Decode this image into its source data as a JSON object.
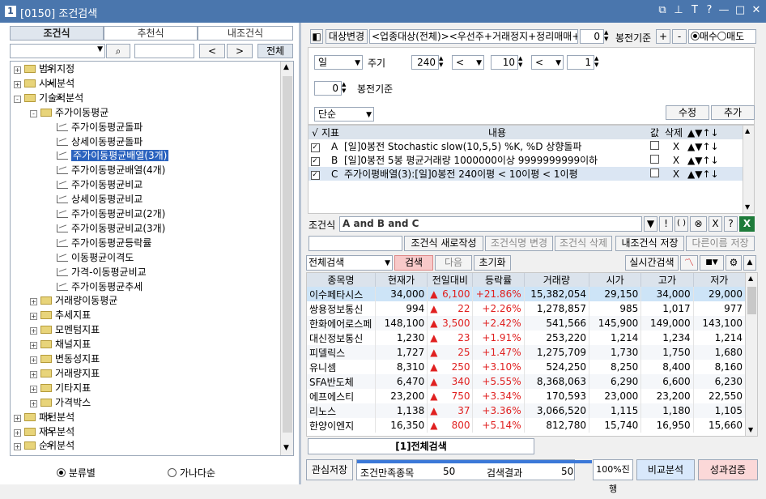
{
  "window": {
    "number": "1",
    "title": "[0150] 조건검색"
  },
  "left": {
    "tabs": [
      "조건식",
      "추천식",
      "내조건식"
    ],
    "all_button": "전체",
    "prev": "<",
    "next": ">",
    "tree": [
      {
        "label": "범위지정",
        "level": 0,
        "type": "folder",
        "pm": "+",
        "arrow": ">"
      },
      {
        "label": "시세분석",
        "level": 0,
        "type": "folder",
        "pm": "+",
        "arrow": ">"
      },
      {
        "label": "기술적분석",
        "level": 0,
        "type": "folder",
        "pm": "-",
        "arrow": ">"
      },
      {
        "label": "주가이동평균",
        "level": 1,
        "type": "folder",
        "pm": "-"
      },
      {
        "label": "주가이동평균돌파",
        "level": 2,
        "type": "item"
      },
      {
        "label": "상세이동평균돌파",
        "level": 2,
        "type": "item"
      },
      {
        "label": "주가이동평균배열(3개)",
        "level": 2,
        "type": "item",
        "selected": true
      },
      {
        "label": "주가이동평균배열(4개)",
        "level": 2,
        "type": "item"
      },
      {
        "label": "주가이동평균비교",
        "level": 2,
        "type": "item"
      },
      {
        "label": "상세이동평균비교",
        "level": 2,
        "type": "item"
      },
      {
        "label": "주가이동평균비교(2개)",
        "level": 2,
        "type": "item"
      },
      {
        "label": "주가이동평균비교(3개)",
        "level": 2,
        "type": "item"
      },
      {
        "label": "주가이동평균등락률",
        "level": 2,
        "type": "item"
      },
      {
        "label": "이동평균이격도",
        "level": 2,
        "type": "item"
      },
      {
        "label": "가격-이동평균비교",
        "level": 2,
        "type": "item"
      },
      {
        "label": "주가이동평균추세",
        "level": 2,
        "type": "item"
      },
      {
        "label": "거래량이동평균",
        "level": 1,
        "type": "folder",
        "pm": "+"
      },
      {
        "label": "추세지표",
        "level": 1,
        "type": "folder",
        "pm": "+"
      },
      {
        "label": "모멘텀지표",
        "level": 1,
        "type": "folder",
        "pm": "+"
      },
      {
        "label": "채널지표",
        "level": 1,
        "type": "folder",
        "pm": "+"
      },
      {
        "label": "변동성지표",
        "level": 1,
        "type": "folder",
        "pm": "+"
      },
      {
        "label": "거래량지표",
        "level": 1,
        "type": "folder",
        "pm": "+"
      },
      {
        "label": "기타지표",
        "level": 1,
        "type": "folder",
        "pm": "+"
      },
      {
        "label": "가격박스",
        "level": 1,
        "type": "folder",
        "pm": "+"
      },
      {
        "label": "패턴분석",
        "level": 0,
        "type": "folder",
        "pm": "+",
        "arrow": ">"
      },
      {
        "label": "재무분석",
        "level": 0,
        "type": "folder",
        "pm": "+",
        "arrow": ">"
      },
      {
        "label": "순위분석",
        "level": 0,
        "type": "folder",
        "pm": "+",
        "arrow": ">"
      }
    ],
    "radio_category": "분류별",
    "radio_alpha": "가나다순"
  },
  "top": {
    "target_change": "대상변경",
    "target_text": "<업종대상(전체)><우선주+거래정지+정리매매+",
    "bong_value": "0",
    "bong_label": "봉전기준",
    "plus": "+",
    "minus": "-",
    "buy": "매수",
    "sell": "매도"
  },
  "params": {
    "period": "일",
    "period_label": "주기",
    "v1": "240",
    "op1": "<",
    "v2": "10",
    "op2": "<",
    "v3": "1",
    "bong": "0",
    "bong_label": "봉전기준",
    "mode": "단순",
    "edit": "수정",
    "add": "추가"
  },
  "cond_table": {
    "headers": [
      "√",
      "지표",
      "내용",
      "값",
      "삭제",
      "▲▼↑↓"
    ],
    "rows": [
      {
        "id": "A",
        "content": "[일]0봉전 Stochastic slow(10,5,5) %K, %D 상향돌파",
        "del": "X"
      },
      {
        "id": "B",
        "content": "[일]0봉전 5봉 평균거래량 1000000이상 9999999999이하",
        "del": "X"
      },
      {
        "id": "C",
        "content": "주가이평배열(3):[일]0봉전 240이평 < 10이평 < 1이평",
        "del": "X"
      }
    ]
  },
  "formula": {
    "label": "조건식",
    "text": "A and B and C",
    "btns": [
      "▼",
      "!",
      "( )",
      "⊗",
      "X",
      "?"
    ]
  },
  "actions": {
    "new_save": "조건식 새로작성",
    "rename": "조건식명 변경",
    "delete": "조건식 삭제",
    "my_save": "내조건식 저장",
    "save_as": "다른이름 저장"
  },
  "search": {
    "scope": "전체검색",
    "search": "검색",
    "next": "다음",
    "reset": "초기화",
    "realtime": "실시간검색"
  },
  "results": {
    "headers": [
      "종목명",
      "현재가",
      "전일대비",
      "등락률",
      "거래량",
      "시가",
      "고가",
      "저가"
    ],
    "rows": [
      [
        "이수페타시스",
        "34,000",
        "6,100",
        "+21.86%",
        "15,382,054",
        "29,150",
        "34,000",
        "29,000"
      ],
      [
        "쌍용정보통신",
        "994",
        "22",
        "+2.26%",
        "1,278,857",
        "985",
        "1,017",
        "977"
      ],
      [
        "한화에어로스페",
        "148,100",
        "3,500",
        "+2.42%",
        "541,566",
        "145,900",
        "149,000",
        "143,100"
      ],
      [
        "대신정보통신",
        "1,230",
        "23",
        "+1.91%",
        "253,220",
        "1,214",
        "1,234",
        "1,214"
      ],
      [
        "피델릭스",
        "1,727",
        "25",
        "+1.47%",
        "1,275,709",
        "1,730",
        "1,750",
        "1,680"
      ],
      [
        "유니셈",
        "8,310",
        "250",
        "+3.10%",
        "524,250",
        "8,250",
        "8,400",
        "8,160"
      ],
      [
        "SFA반도체",
        "6,470",
        "340",
        "+5.55%",
        "8,368,063",
        "6,290",
        "6,600",
        "6,230"
      ],
      [
        "에프에스티",
        "23,200",
        "750",
        "+3.34%",
        "170,593",
        "23,000",
        "23,200",
        "22,550"
      ],
      [
        "리노스",
        "1,138",
        "37",
        "+3.36%",
        "3,066,520",
        "1,115",
        "1,180",
        "1,105"
      ],
      [
        "한양이엔지",
        "16,350",
        "800",
        "+5.14%",
        "812,780",
        "15,740",
        "16,950",
        "15,660"
      ]
    ]
  },
  "bottom": {
    "tab": "[1]전체검색",
    "watch_save": "관심저장",
    "match_label": "조건만족종목",
    "match_value": "50",
    "result_label": "검색결과",
    "result_value": "50",
    "progress": "100%진행",
    "compare": "비교분석",
    "verify": "성과검증"
  },
  "colors": {
    "title": "#4a76ad",
    "up": "#e02020",
    "highlight": "#cde4f7",
    "select": "#2b63bf"
  }
}
